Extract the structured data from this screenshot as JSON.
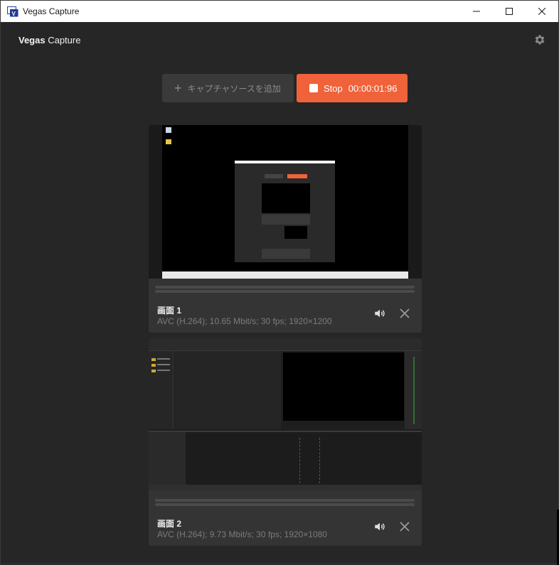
{
  "window": {
    "title": "Vegas Capture"
  },
  "header": {
    "brand_bold": "Vegas",
    "brand_rest": " Capture",
    "settings_icon": "gear-icon"
  },
  "actions": {
    "add_source_label": "キャプチャソースを追加",
    "stop_label": "Stop",
    "timer": "00:00:01:96",
    "stop_color": "#f0623a"
  },
  "sources": [
    {
      "name": "画面 1",
      "info": "AVC (H.264); 10.65 Mbit/s; 30 fps; 1920×1200"
    },
    {
      "name": "画面 2",
      "info": "AVC (H.264); 9.73 Mbit/s; 30 fps; 1920×1080"
    }
  ]
}
